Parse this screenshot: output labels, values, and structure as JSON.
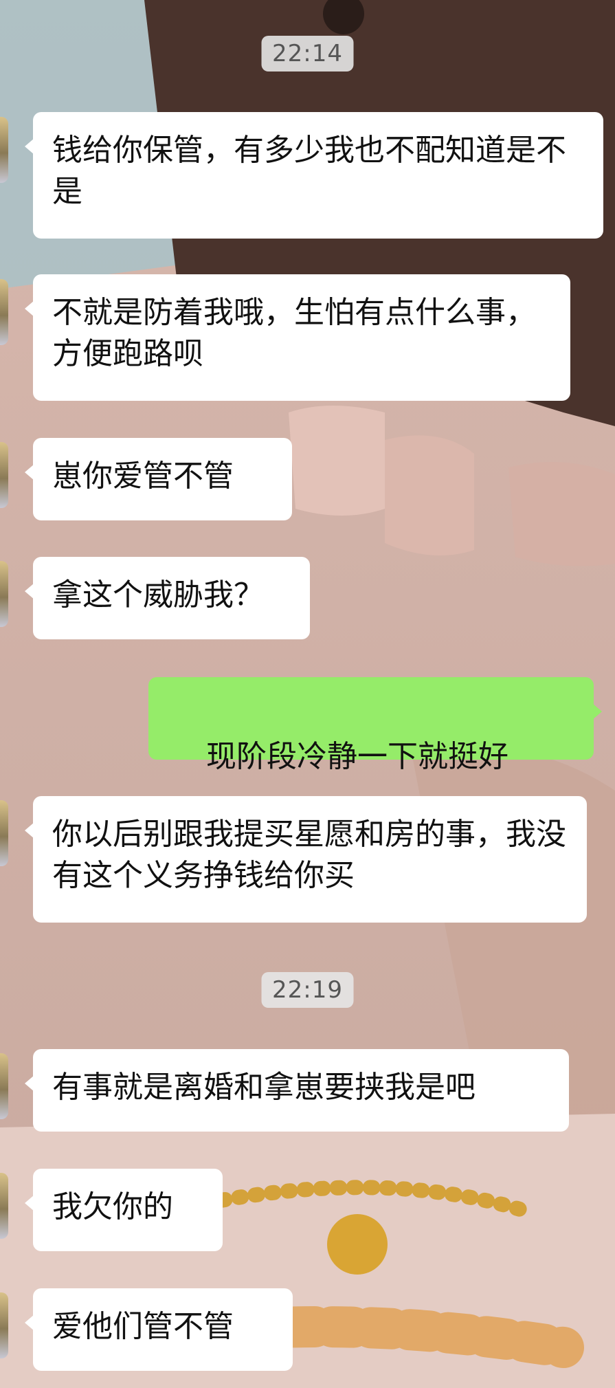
{
  "timestamps": [
    "22:14",
    "22:19"
  ],
  "messages": [
    {
      "side": "in",
      "text": "钱给你保管，有多少我也不配知道是不是"
    },
    {
      "side": "in",
      "text": "不就是防着我哦，生怕有点什么事，方便跑路呗"
    },
    {
      "side": "in",
      "text": "崽你爱管不管"
    },
    {
      "side": "in",
      "text": "拿这个威胁我？"
    },
    {
      "side": "out",
      "text": "现阶段冷静一下就挺好",
      "emoji": "slightly-smiling-face-icon"
    },
    {
      "side": "in",
      "text": "你以后别跟我提买星愿和房的事，我没有这个义务挣钱给你买"
    },
    {
      "side": "in",
      "text": "有事就是离婚和拿崽要挟我是吧"
    },
    {
      "side": "in",
      "text": "我欠你的"
    },
    {
      "side": "in",
      "text": "爱他们管不管"
    }
  ],
  "colors": {
    "incoming_bubble": "#ffffff",
    "outgoing_bubble": "#95ec69",
    "timestamp_bg": "#e6e6e6"
  }
}
